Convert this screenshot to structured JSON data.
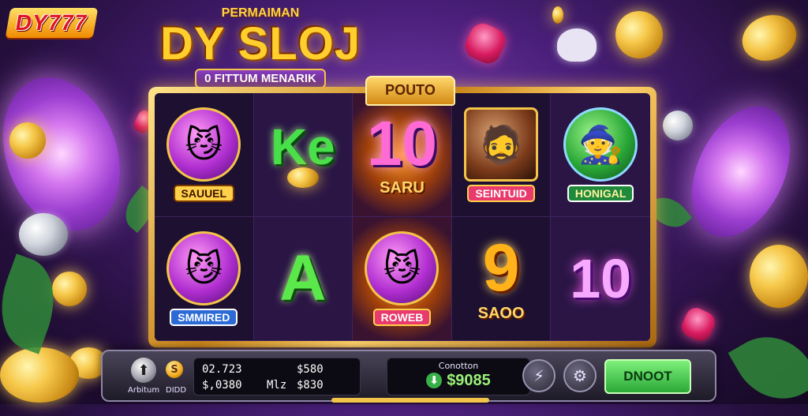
{
  "logo": {
    "text": "DY777"
  },
  "title": {
    "top": "PERMAIMAN",
    "main": "DY SLOJ",
    "sub": "0 FITTUM MENARIK"
  },
  "reel_tab": {
    "label": "POUTO"
  },
  "reels": {
    "row1": [
      {
        "kind": "badge",
        "label": "SAUUEL",
        "icon": "cat-mask-icon"
      },
      {
        "kind": "letter",
        "text": "Ke",
        "icon": "coin-stack-icon"
      },
      {
        "kind": "letter",
        "text": "10",
        "label": "SARU"
      },
      {
        "kind": "badge",
        "label": "SEINTUID",
        "icon": "warrior-icon"
      },
      {
        "kind": "badge",
        "label": "HONIGAL",
        "icon": "green-hood-icon"
      }
    ],
    "row2": [
      {
        "kind": "badge",
        "label": "SMMIRED",
        "icon": "cat-mask-icon"
      },
      {
        "kind": "letter",
        "text": "A"
      },
      {
        "kind": "badge",
        "label": "ROWEB",
        "icon": "cat-mask-icon"
      },
      {
        "kind": "letter",
        "text": "9",
        "label": "SAOO"
      },
      {
        "kind": "letter",
        "text": "10"
      }
    ]
  },
  "panel": {
    "autospin_label": "Arbitum",
    "coin_label": "DIDD",
    "coin_symbol": "S",
    "line1_left": "02.723",
    "line1_right": "$580",
    "line2_left": "$,0380",
    "line2_mid": "Mlz",
    "line2_right": "$830",
    "win_label": "Conotton",
    "win_amount": "$9085",
    "spin_label": "DNOOT"
  },
  "colors": {
    "accent_gold": "#f3c44a",
    "spin_green": "#2aa838",
    "bg_purple": "#4a1f7a"
  }
}
